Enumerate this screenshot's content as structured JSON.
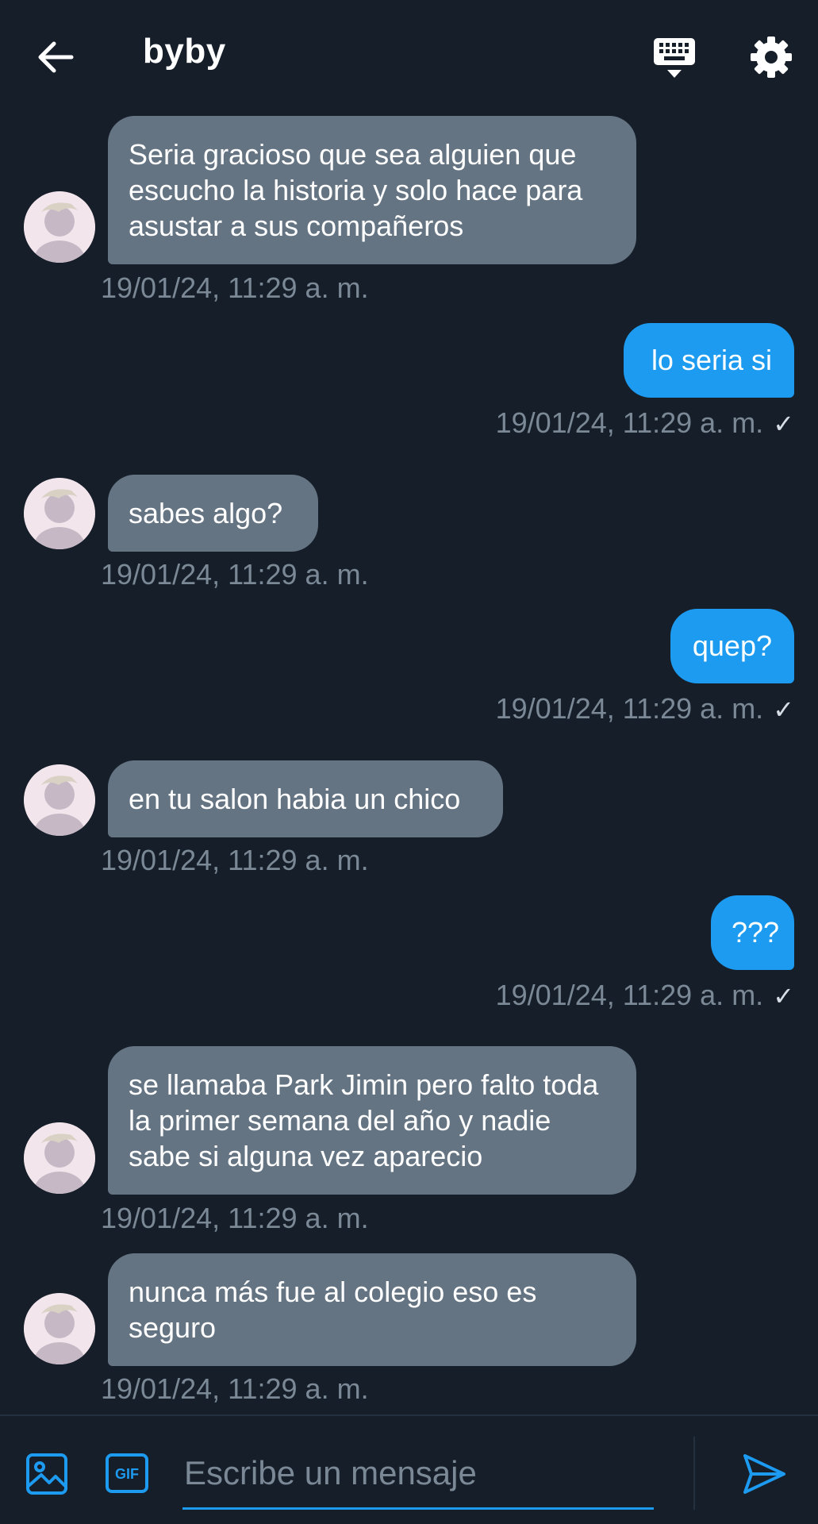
{
  "header": {
    "title": "byby",
    "back_icon": "arrow-left-icon",
    "keyboard_icon": "keyboard-icon",
    "settings_icon": "gear-icon"
  },
  "messages": [
    {
      "direction": "in",
      "text": "Seria gracioso que sea alguien que escucho la historia y solo hace para asustar a sus compañeros",
      "time": "19/01/24, 11:29 a. m."
    },
    {
      "direction": "out",
      "text": "lo seria si",
      "time": "19/01/24, 11:29 a. m.",
      "read_mark": "✓"
    },
    {
      "direction": "in",
      "text": "sabes algo?",
      "time": "19/01/24, 11:29 a. m."
    },
    {
      "direction": "out",
      "text": "quep?",
      "time": "19/01/24, 11:29 a. m.",
      "read_mark": "✓"
    },
    {
      "direction": "in",
      "text": "en tu salon habia un chico",
      "time": "19/01/24, 11:29 a. m."
    },
    {
      "direction": "out",
      "text": "???",
      "time": "19/01/24, 11:29 a. m.",
      "read_mark": "✓"
    },
    {
      "direction": "in",
      "text": "se llamaba Park Jimin pero falto toda la primer semana del año y nadie sabe si alguna vez aparecio",
      "time": "19/01/24, 11:29 a. m."
    },
    {
      "direction": "in",
      "text": "nunca más fue al colegio eso es seguro",
      "time": "19/01/24, 11:29 a. m."
    }
  ],
  "composer": {
    "placeholder": "Escribe un mensaje",
    "gif_label": "GIF",
    "image_icon": "image-icon",
    "send_icon": "send-icon"
  },
  "colors": {
    "background": "#161e2a",
    "incoming_bubble": "#657483",
    "outgoing_bubble": "#1d9bf0",
    "timestamp": "#7b8896"
  }
}
